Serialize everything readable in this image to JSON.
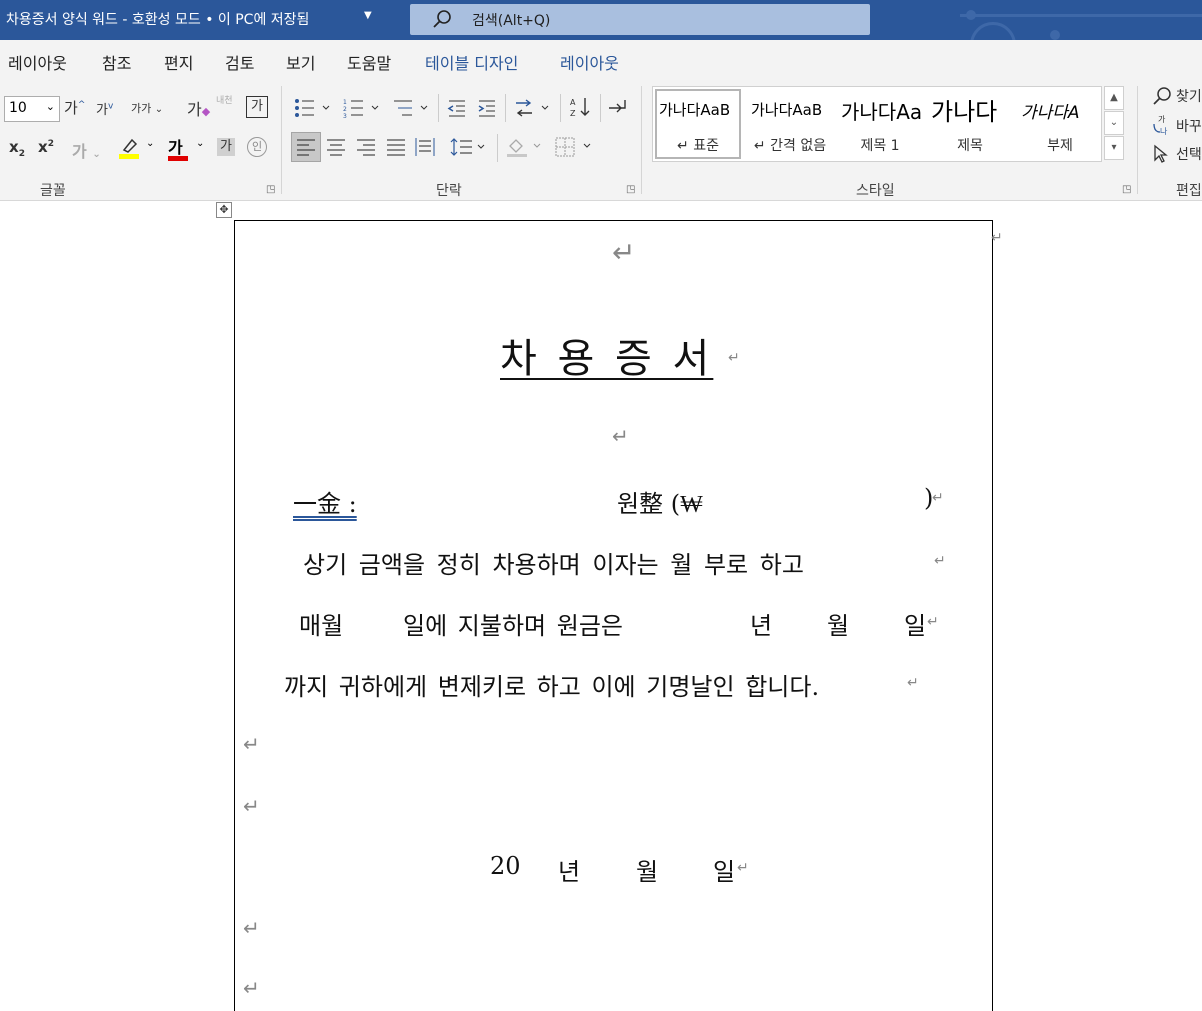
{
  "titlebar": {
    "title": "차용증서 양식 워드  -  호환성 모드 • 이 PC에 저장됨",
    "search_placeholder": "검색(Alt+Q)"
  },
  "menu": {
    "items": [
      "레이아웃",
      "참조",
      "편지",
      "검토",
      "보기",
      "도움말"
    ],
    "context_items": [
      "테이블 디자인",
      "레이아웃"
    ]
  },
  "ribbon": {
    "font_size": "10",
    "groups": {
      "font": "글꼴",
      "paragraph": "단락",
      "styles": "스타일",
      "editing": "편집"
    },
    "font_buttons": {
      "grow": "가",
      "shrink": "가",
      "case": "가가",
      "clear": "가",
      "phonetic": "내천",
      "border": "가",
      "subscript": "x",
      "superscript": "x",
      "effects": "가",
      "color": "가",
      "shading": "가",
      "enclose": "인"
    },
    "styles": [
      {
        "sample": "가나다AaB",
        "label": "↵ 표준"
      },
      {
        "sample": "가나다AaB",
        "label": "↵ 간격 없음"
      },
      {
        "sample": "가나다Aa",
        "label": "제목 1"
      },
      {
        "sample": "가나다",
        "label": "제목"
      },
      {
        "sample": "가나다A",
        "label": "부제"
      }
    ],
    "editing_items": [
      "찾기",
      "바꾸기",
      "선택"
    ]
  },
  "document": {
    "heading": "차 용 증 서",
    "amount_label": "一金 :",
    "amount_won": "원整 (₩",
    "amount_close": ")",
    "line1": "상기 금액을 정히 차용하며 이자는 월      부로 하고",
    "line2_a": "매월",
    "line2_b": "일에 지불하며 원금은",
    "line2_c": "년",
    "line2_d": "월",
    "line2_e": "일",
    "line3": "까지 귀하에게 변제키로 하고 이에 기명날인 합니다.",
    "date_year": "20",
    "date_y": "년",
    "date_m": "월",
    "date_d": "일"
  },
  "colors": {
    "titlebar": "#2b579a",
    "highlight": "#ffff00",
    "font_color": "#e00000"
  }
}
